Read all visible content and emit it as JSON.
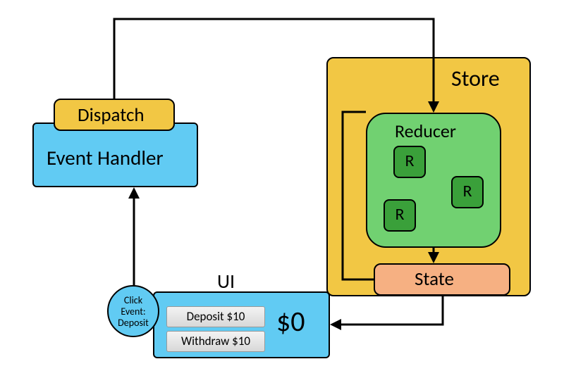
{
  "store": {
    "title": "Store"
  },
  "reducer": {
    "title": "Reducer",
    "children": [
      "R",
      "R",
      "R"
    ]
  },
  "state": {
    "title": "State"
  },
  "dispatch": {
    "title": "Dispatch"
  },
  "event_handler": {
    "title": "Event Handler"
  },
  "ui": {
    "title": "UI",
    "balance": "$0",
    "buttons": {
      "deposit": "Deposit $10",
      "withdraw": "Withdraw $10"
    }
  },
  "click_event": {
    "line1": "Click",
    "line2": "Event:",
    "line3": "Deposit"
  },
  "colors": {
    "store": "#f2c744",
    "cyan": "#61cbf3",
    "reducer": "#71d171",
    "reducer_child": "#3aa03a",
    "state": "#f6b082"
  }
}
